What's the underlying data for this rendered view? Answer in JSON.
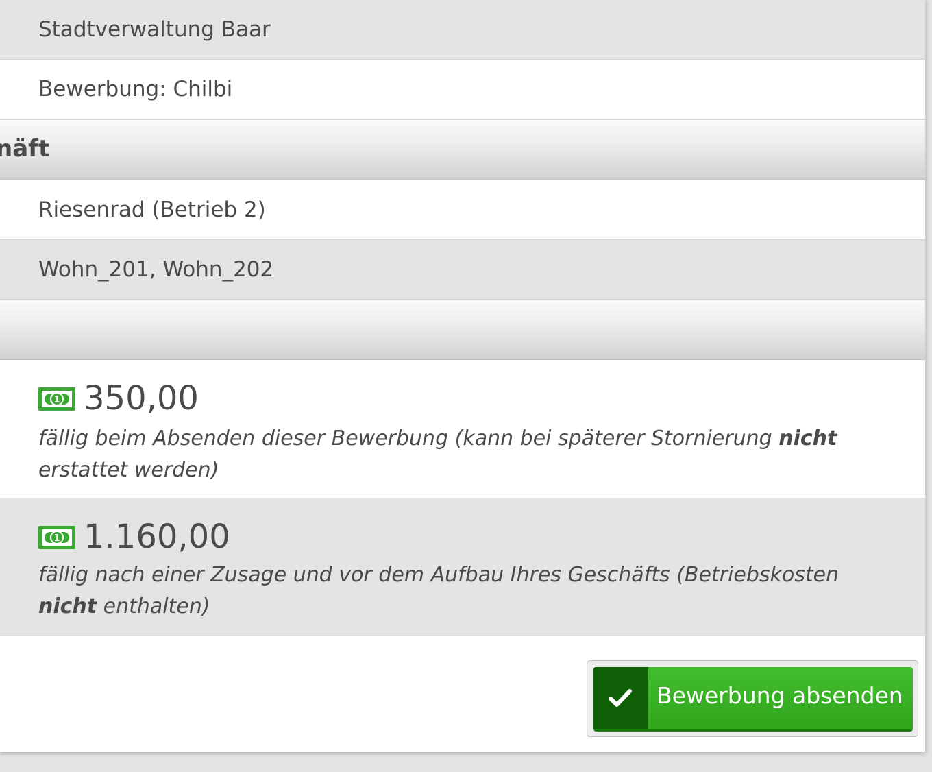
{
  "rows": [
    {
      "text": "Stadtverwaltung Baar"
    },
    {
      "text": "Bewerbung: Chilbi"
    }
  ],
  "section_title": "näft",
  "business": {
    "name": "Riesenrad (Betrieb 2)",
    "vehicles": "Wohn_201, Wohn_202"
  },
  "fees": [
    {
      "icon": "money-bill-icon",
      "amount": "350,00",
      "note_before": "fällig beim Absenden dieser Bewerbung (kann bei späterer Stornierung ",
      "note_bold": "nicht",
      "note_after": " erstattet werden)"
    },
    {
      "icon": "money-bill-icon",
      "amount": "1.160,00",
      "note_before": "fällig nach einer Zusage und vor dem Aufbau Ihres Geschäfts (Betriebskosten ",
      "note_bold": "nicht",
      "note_after": " enthalten)"
    }
  ],
  "submit_button": {
    "label": "Bewerbung absenden",
    "icon": "check-icon"
  },
  "colors": {
    "button_green": "#2fa51c",
    "button_icon_bg": "#0f5f07",
    "money_icon_green": "#3aa832",
    "row_gray": "#e4e4e4"
  }
}
